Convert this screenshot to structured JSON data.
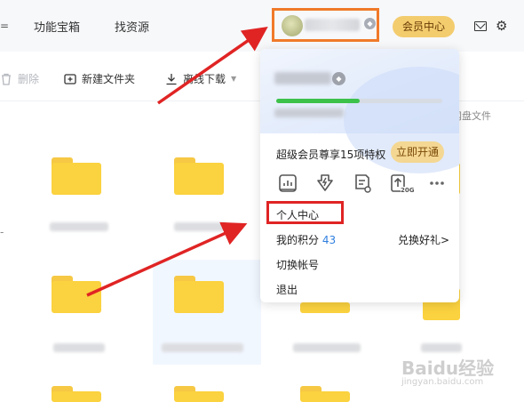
{
  "nav": {
    "edge_glyph": "=",
    "items": [
      {
        "label": "功能宝箱"
      },
      {
        "label": "找资源"
      }
    ],
    "vip_center_label": "会员中心",
    "icons": [
      "mail-icon",
      "gear-icon"
    ]
  },
  "toolbar": {
    "delete_label": "删除",
    "new_folder_label": "新建文件夹",
    "offline_download_label": "离线下载"
  },
  "subbar": {
    "right_text": "网盘文件"
  },
  "dropdown": {
    "storage_used_fraction": 0.5,
    "vip_promo_text": "超级会员尊享15项特权",
    "open_now_label": "立即开通",
    "perk_icons": [
      "report-icon",
      "fast-download-icon",
      "doc-convert-icon",
      "upload-20g-icon",
      "more-icon"
    ],
    "upload_badge": "20G",
    "menu": {
      "personal_center": "个人中心",
      "points_label": "我的积分",
      "points_value": "43",
      "redeem_label": "兑换好礼>",
      "switch_account": "切换帐号",
      "logout": "退出"
    }
  },
  "colors": {
    "vip_gold": "#f3cc6e",
    "progress_green": "#3cc24b",
    "annotation_red": "#e02424",
    "annotation_orange": "#f07a2a",
    "folder_yellow": "#fbd23f"
  },
  "watermark": {
    "text": "Baidu经验",
    "sub": "jingyan.baidu.com"
  }
}
